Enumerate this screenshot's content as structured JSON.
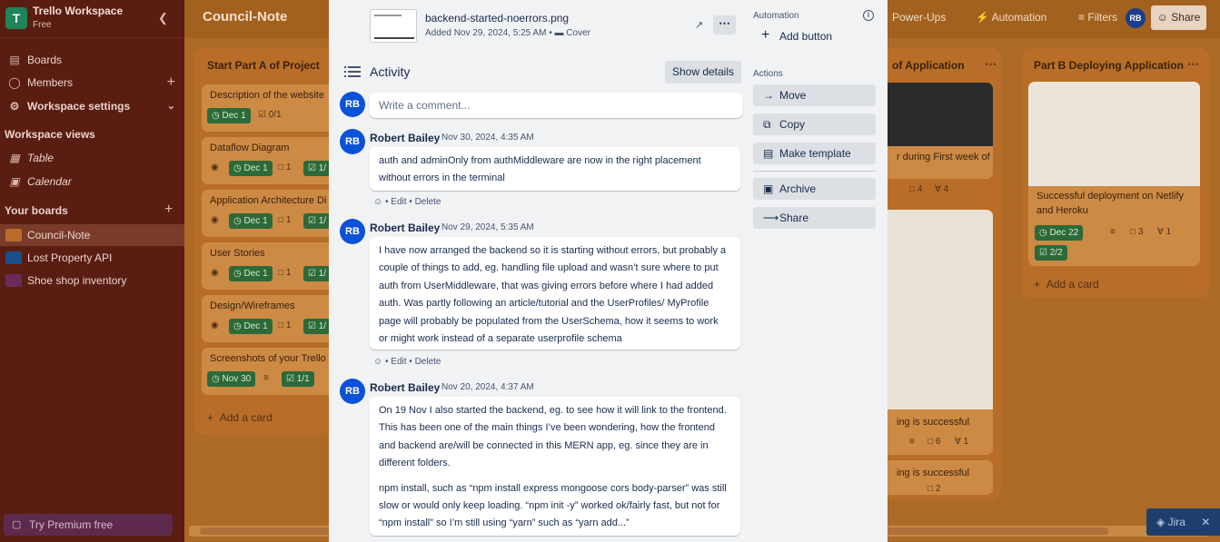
{
  "sidebar": {
    "workspace_initial": "T",
    "workspace_name": "Trello Workspace",
    "workspace_plan": "Free",
    "nav": [
      {
        "label": "Boards",
        "icon": "boards-icon"
      },
      {
        "label": "Members",
        "icon": "members-icon"
      },
      {
        "label": "Workspace settings",
        "icon": "settings-icon"
      }
    ],
    "views_heading": "Workspace views",
    "views": [
      {
        "label": "Table",
        "icon": "table-icon"
      },
      {
        "label": "Calendar",
        "icon": "calendar-icon"
      }
    ],
    "boards_heading": "Your boards",
    "boards": [
      {
        "label": "Council-Note",
        "color": "#b86c2a"
      },
      {
        "label": "Lost Property API",
        "color": "#1b4f8a"
      },
      {
        "label": "Shoe shop inventory",
        "color": "#6a2a5c"
      }
    ],
    "premium_label": "Try Premium free"
  },
  "topbar": {
    "board_title": "Council-Note",
    "power_ups": "Power-Ups",
    "automation": "Automation",
    "filters": "Filters",
    "avatar": "RB",
    "share": "Share"
  },
  "lists": {
    "list1": {
      "title": "Start Part A of Project",
      "cards": [
        {
          "title": "Description of the website",
          "date": "Dec 1",
          "checklist": "0/1"
        },
        {
          "title": "Dataflow Diagram",
          "date": "Dec 1",
          "comments": "1",
          "checklist": "1/"
        },
        {
          "title": "Application Architecture Di",
          "date": "Dec 1",
          "comments": "1",
          "checklist": "1/"
        },
        {
          "title": "User Stories",
          "date": "Dec 1",
          "comments": "1",
          "checklist": "1/"
        },
        {
          "title": "Design/Wireframes",
          "date": "Dec 1",
          "comments": "1",
          "checklist": "1/"
        },
        {
          "title": "Screenshots of your Trello",
          "date": "Nov 30",
          "checklist": "1/1"
        }
      ],
      "add_card": "Add a card"
    },
    "list2": {
      "title": "of Application",
      "card1_title": "r during First week of",
      "card1_comments": "4",
      "card1_attachments": "4",
      "card2_title": "ing is successful",
      "card2_comments": "6",
      "card2_attachments": "1",
      "card3_title": "ing is successful",
      "card3_comments": "2"
    },
    "list3": {
      "title": "Part B Deploying Application",
      "card_title_line1": "Successful deployment on Netlify",
      "card_title_line2": "and Heroku",
      "date": "Dec 22",
      "comments": "3",
      "attachments": "1",
      "checklist": "2/2",
      "add_card": "Add a card"
    }
  },
  "modal": {
    "attachment": {
      "name": "backend-started-noerrors.png",
      "added": "Added Nov 29, 2024, 5:25 AM",
      "cover": "Cover",
      "more": "⋯"
    },
    "activity_title": "Activity",
    "show_details": "Show details",
    "comment_placeholder": "Write a comment...",
    "avatar": "RB",
    "comments": [
      {
        "author": "Robert Bailey",
        "time": "Nov 30, 2024, 4:35 AM",
        "line1": "auth and adminOnly from authMiddleware are now in the right placement",
        "line2": "without errors in the terminal",
        "edit": "Edit",
        "delete": "Delete"
      },
      {
        "author": "Robert Bailey",
        "time": "Nov 29, 2024, 5:35 AM",
        "line1": "I have now arranged the backend so it is starting without errors, but probably a",
        "line2": "couple of things to add, eg. handling file upload and wasn’t sure where to put",
        "line3": "auth from UserMiddleware, that was giving errors before where I had added",
        "line4": "auth. Was partly following an article/tutorial and the UserProfiles/ MyProfile",
        "line5": "page will probably be populated from the UserSchema, how it seems to work",
        "line6": "or might work instead of a separate userprofile schema",
        "edit": "Edit",
        "delete": "Delete"
      },
      {
        "author": "Robert Bailey",
        "time": "Nov 20, 2024, 4:37 AM",
        "p1_line1": "On 19 Nov I also started the backend, eg. to see how it will link to the frontend.",
        "p1_line2": "This has been one of the main things I’ve been wondering, how the frontend",
        "p1_line3": "and backend are/will be connected in this MERN app, eg. since they are in",
        "p1_line4": "different folders.",
        "p2_line1": "npm install, such as “npm install express mongoose cors body-parser” was still",
        "p2_line2": "slow or would only keep loading. “npm init -y” worked ok/fairly fast, but not for",
        "p2_line3": "“npm install” so I’m still using “yarn” such as “yarn add...”"
      }
    ],
    "side": {
      "automation_label": "Automation",
      "add_button": "Add button",
      "actions_label": "Actions",
      "move": "Move",
      "copy": "Copy",
      "make_template": "Make template",
      "archive": "Archive",
      "share": "Share"
    }
  },
  "jira_label": "Jira",
  "colors": {
    "accent": "#0c52d6",
    "date_chip": "#2d6a3a",
    "sidebar_bg": "#5a1d12"
  }
}
